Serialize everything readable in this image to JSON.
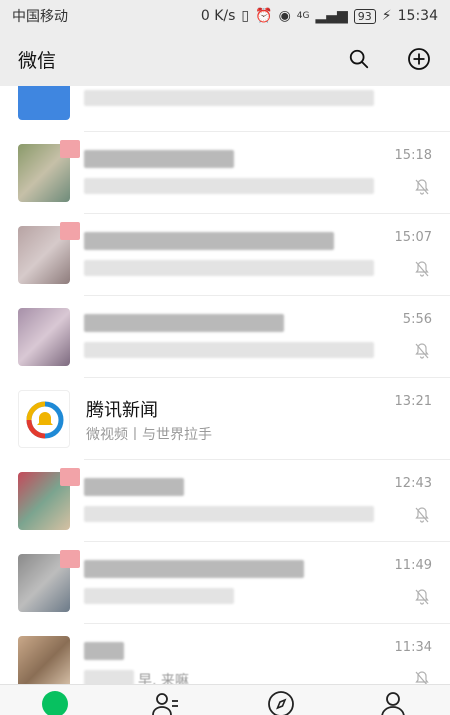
{
  "status_bar": {
    "carrier": "中国移动",
    "net_speed": "0 K/s",
    "network": "4G",
    "battery": "93",
    "time": "15:34"
  },
  "header": {
    "title": "微信",
    "search_icon": "search-icon",
    "add_icon": "plus-circle-icon"
  },
  "chats": [
    {
      "time": "",
      "muted": false
    },
    {
      "time": "15:18",
      "muted": true
    },
    {
      "time": "15:07",
      "muted": true
    },
    {
      "time": "5:56",
      "muted": true
    },
    {
      "name": "腾讯新闻",
      "preview": "微视频丨与世界拉手",
      "time": "13:21",
      "muted": false
    },
    {
      "time": "12:43",
      "muted": true
    },
    {
      "time": "11:49",
      "muted": true
    },
    {
      "time": "11:34",
      "muted": true,
      "preview_fragment": "早, 来嘛"
    }
  ],
  "tabbar": {
    "tabs": [
      "chats-tab-icon",
      "contacts-icon",
      "discover-compass-icon",
      "me-person-icon"
    ],
    "active_color": "#07c160"
  }
}
